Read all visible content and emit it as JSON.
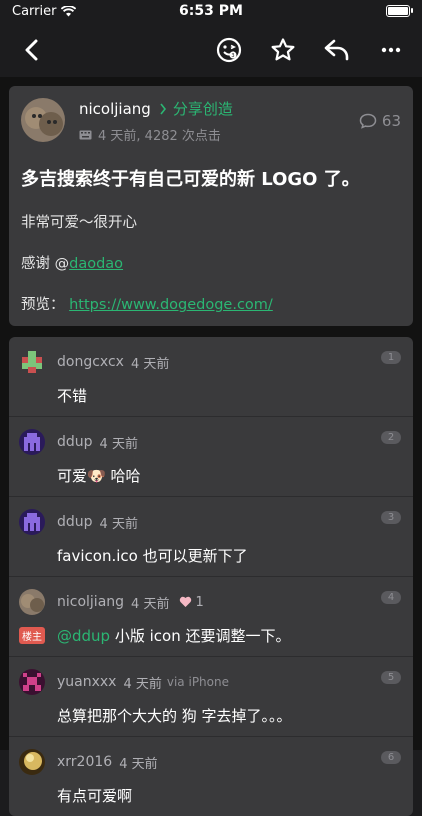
{
  "status": {
    "carrier": "Carrier",
    "time": "6:53 PM"
  },
  "nav": {
    "back_icon": "chevron-left-icon",
    "actions": [
      "smiley-icon",
      "star-icon",
      "reply-icon",
      "more-icon"
    ]
  },
  "post": {
    "author": "nicoljiang",
    "node": "分享创造",
    "meta": "4 天前, 4282 次点击",
    "reply_count": "63",
    "title": "多吉搜索终于有自己可爱的新 LOGO 了。",
    "line1": "非常可爱～很开心",
    "thanks_prefix": "感谢 ",
    "thanks_at": "@",
    "thanks_user": "daodao",
    "preview_label": "预览： ",
    "preview_url": "https://www.dogedoge.com/"
  },
  "comments": [
    {
      "name": "dongcxcx",
      "time": "4 天前",
      "floor": "1",
      "text": "不错"
    },
    {
      "name": "ddup",
      "time": "4 天前",
      "floor": "2",
      "text": "可爱🐶 哈哈"
    },
    {
      "name": "ddup",
      "time": "4 天前",
      "floor": "3",
      "text": "favicon.ico 也可以更新下了"
    },
    {
      "name": "nicoljiang",
      "time": "4 天前",
      "floor": "4",
      "likes": "1",
      "badge": "楼主",
      "mention": "@ddup",
      "text": " 小版 icon 还要调整一下。"
    },
    {
      "name": "yuanxxx",
      "time": "4 天前",
      "source": "via iPhone",
      "floor": "5",
      "text": "总算把那个大大的 狗 字去掉了。。。"
    },
    {
      "name": "xrr2016",
      "time": "4 天前",
      "floor": "6",
      "text": "有点可爱啊"
    }
  ],
  "colors": {
    "accent": "#2bb673",
    "card": "#3a3a3c",
    "bg": "#121212",
    "badge": "#e05a50"
  }
}
